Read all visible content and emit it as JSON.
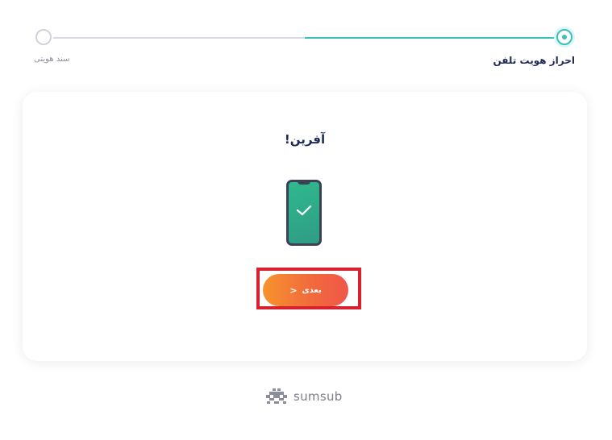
{
  "stepper": {
    "steps": [
      {
        "label": "سند هویتی",
        "state": "inactive"
      },
      {
        "label": "احراز هویت تلفن",
        "state": "active"
      }
    ],
    "colors": {
      "active": "#3bbfba",
      "inactive": "#d9d9e3"
    }
  },
  "card": {
    "title": "آفرین!",
    "icon": "phone-check-icon",
    "next_button": {
      "label": "بعدی",
      "arrow": ">"
    },
    "button_gradient": [
      "#f7932d",
      "#f0564a"
    ],
    "highlight_color": "#d8212c"
  },
  "footer": {
    "brand_name": "sumsub",
    "icon": "sumsub-logo-icon"
  }
}
